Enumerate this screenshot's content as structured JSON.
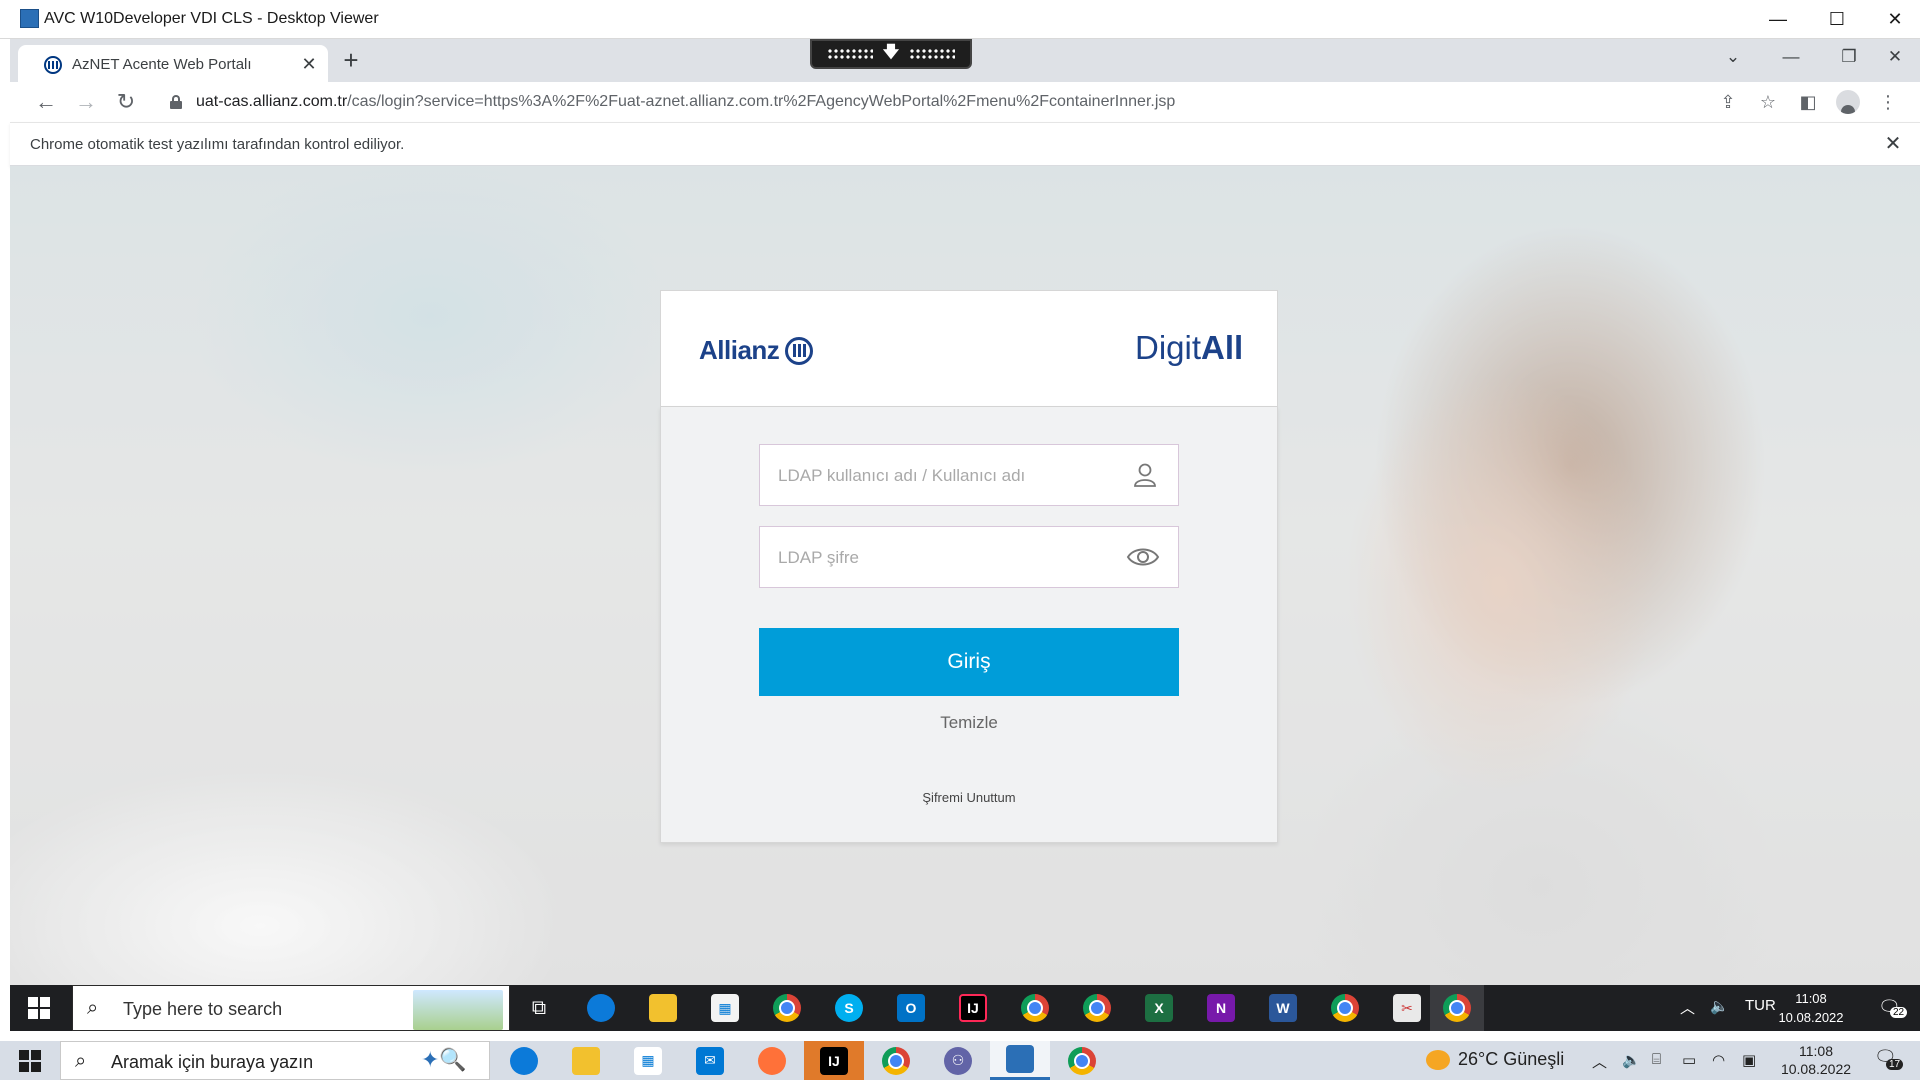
{
  "vdi_window": {
    "title": "AVC W10Developer VDI CLS - Desktop Viewer",
    "minimize": "—",
    "maximize": "☐",
    "close": "✕"
  },
  "browser": {
    "tab_title": "AzNET Acente Web Portalı",
    "tab_close": "✕",
    "new_tab": "+",
    "url_host": "uat-cas.allianz.com.tr",
    "url_path": "/cas/login?service=https%3A%2F%2Fuat-aznet.allianz.com.tr%2FAgencyWebPortal%2Fmenu%2FcontainerInner.jsp",
    "infobar_text": "Chrome otomatik test yazılımı tarafından kontrol ediliyor.",
    "infobar_close": "✕"
  },
  "login": {
    "brand_left": "Allianz",
    "brand_right_regular": "Digit",
    "brand_right_bold": "All",
    "username_placeholder": "LDAP kullanıcı adı / Kullanıcı adı",
    "password_placeholder": "LDAP şifre",
    "username_value": "",
    "password_value": "",
    "login_button": "Giriş",
    "clear_link": "Temizle",
    "forgot_link": "Şifremi Unuttum"
  },
  "remote_taskbar": {
    "search_placeholder": "Type here to search",
    "language": "TUR",
    "time": "11:08",
    "date": "10.08.2022",
    "notification_count": "22"
  },
  "local_taskbar": {
    "search_placeholder": "Aramak için buraya yazın",
    "weather": "26°C  Güneşli",
    "time": "11:08",
    "date": "10.08.2022",
    "notification_count": "17"
  },
  "colors": {
    "brand_blue": "#1c4289",
    "login_button": "#009dd9",
    "card_background": "#f1f2f3"
  }
}
